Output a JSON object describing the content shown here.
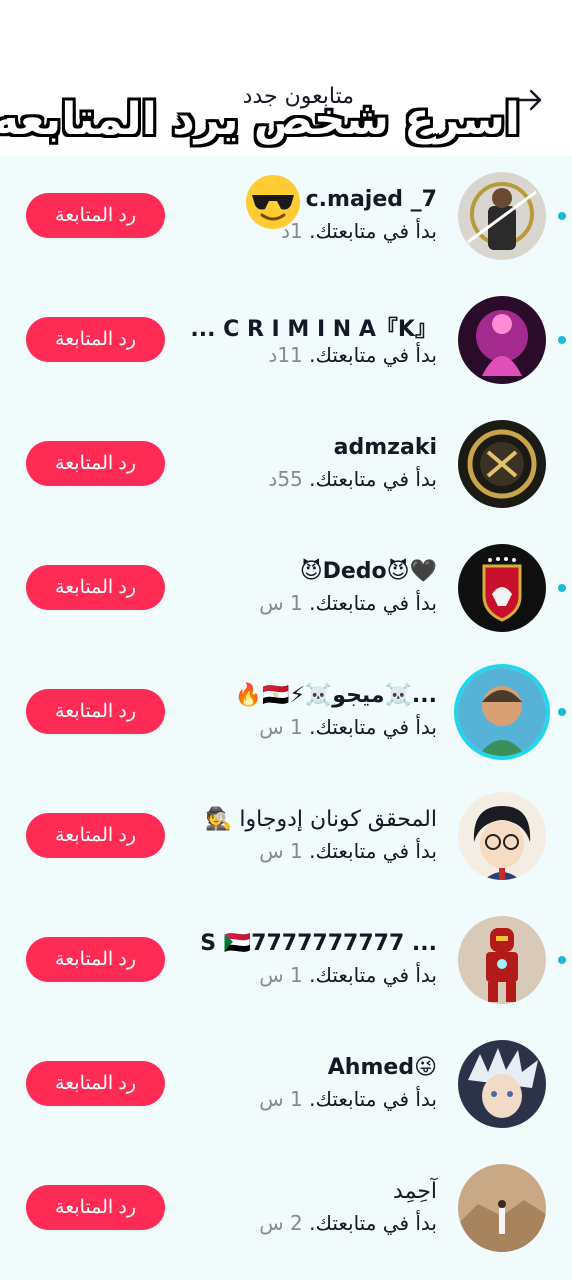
{
  "header": {
    "subtitle": "متابعون جدد",
    "headline": "اسرع شخص يرد المتابعه"
  },
  "colors": {
    "accent": "#fe2c55",
    "online_dot": "#20b8d9",
    "list_bg": "#f1fbfc"
  },
  "rows": [
    {
      "name": "c.majed _7",
      "action": "بدأ في متابعتك.",
      "time": "1د",
      "button": "رد المتابعة",
      "avatar": "real-madrid-player-avatar"
    },
    {
      "name": "『K』C R I M I N A ...",
      "action": "بدأ في متابعتك.",
      "time": "11د",
      "button": "رد المتابعة",
      "avatar": "neon-figure-avatar"
    },
    {
      "name": "admzaki",
      "action": "بدأ في متابعتك.",
      "time": "55د",
      "button": "رد المتابعة",
      "avatar": "gold-crest-avatar"
    },
    {
      "name": "🖤😈Dedo😈",
      "action": "بدأ في متابعتك.",
      "time": "1 س",
      "button": "رد المتابعة",
      "avatar": "al-ahly-logo-avatar"
    },
    {
      "name": "...☠️ميجو☠️⚡🇪🇬🔥",
      "action": "بدأ في متابعتك.",
      "time": "1 س",
      "button": "رد المتابعة",
      "avatar": "boy-photo-avatar"
    },
    {
      "name": "المحقق كونان إدوجاوا 🕵️",
      "action": "بدأ في متابعتك.",
      "time": "1 س",
      "button": "رد المتابعة",
      "avatar": "conan-avatar"
    },
    {
      "name": "... S 🇸🇩7777777777",
      "action": "بدأ في متابعتك.",
      "time": "1 س",
      "button": "رد المتابعة",
      "avatar": "iron-man-avatar"
    },
    {
      "name": "😜Ahmed",
      "action": "بدأ في متابعتك.",
      "time": "1 س",
      "button": "رد المتابعة",
      "avatar": "anime-boy-avatar"
    },
    {
      "name": "آحِمِد",
      "action": "بدأ في متابعتك.",
      "time": "2 س",
      "button": "رد المتابعة",
      "avatar": "desert-photo-avatar"
    }
  ]
}
